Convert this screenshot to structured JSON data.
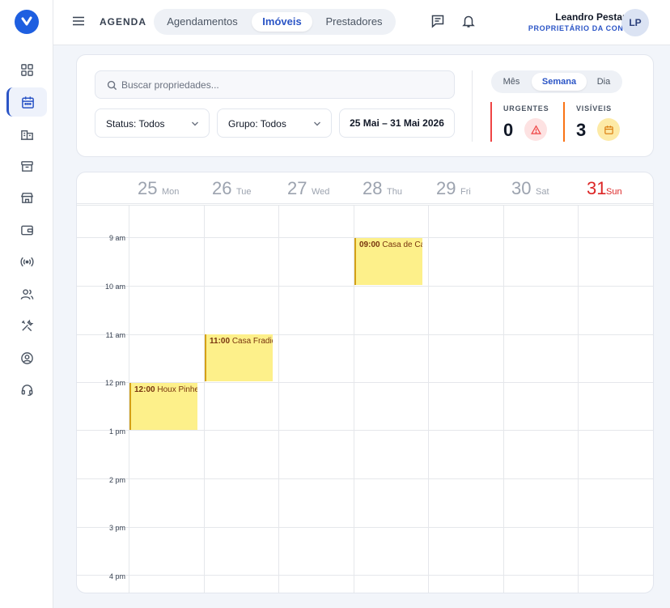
{
  "header": {
    "title": "AGENDA",
    "tabs": [
      {
        "label": "Agendamentos",
        "active": false
      },
      {
        "label": "Imóveis",
        "active": true
      },
      {
        "label": "Prestadores",
        "active": false
      }
    ],
    "user": {
      "name": "Leandro Pestana",
      "role": "PROPRIETÁRIO DA CONTA",
      "initials": "LP"
    }
  },
  "sidebar": {
    "items": [
      {
        "icon": "grid-icon",
        "active": false
      },
      {
        "icon": "calendar-icon",
        "active": true
      },
      {
        "icon": "buildings-icon",
        "active": false
      },
      {
        "icon": "archive-icon",
        "active": false
      },
      {
        "icon": "store-icon",
        "active": false
      },
      {
        "icon": "wallet-icon",
        "active": false
      },
      {
        "icon": "broadcast-icon",
        "active": false
      },
      {
        "icon": "users-icon",
        "active": false
      },
      {
        "icon": "tools-icon",
        "active": false
      },
      {
        "icon": "user-circle-icon",
        "active": false
      },
      {
        "icon": "headset-icon",
        "active": false
      }
    ]
  },
  "filters": {
    "search_placeholder": "Buscar propriedades...",
    "status": "Status: Todos",
    "group": "Grupo: Todos",
    "date_range": "25 Mai – 31 Mai 2026",
    "views": [
      {
        "label": "Mês",
        "active": false
      },
      {
        "label": "Semana",
        "active": true
      },
      {
        "label": "Dia",
        "active": false
      }
    ],
    "stats": [
      {
        "label": "URGENTES",
        "value": "0",
        "color": "#ef4444",
        "icon": "warning-icon"
      },
      {
        "label": "VISÍVEIS",
        "value": "3",
        "color": "#f97316",
        "icon": "calendar-icon"
      }
    ]
  },
  "calendar": {
    "days": [
      {
        "num": "25",
        "name": "Mon"
      },
      {
        "num": "26",
        "name": "Tue"
      },
      {
        "num": "27",
        "name": "Wed"
      },
      {
        "num": "28",
        "name": "Thu"
      },
      {
        "num": "29",
        "name": "Fri"
      },
      {
        "num": "30",
        "name": "Sat"
      },
      {
        "num": "31",
        "name": "Sun"
      }
    ],
    "times": [
      "9 am",
      "10 am",
      "11 am",
      "12 pm",
      "1 pm",
      "2 pm",
      "3 pm",
      "4 pm"
    ],
    "events": [
      {
        "time": "09:00",
        "title": "Casa de Campo",
        "day": "28"
      },
      {
        "time": "11:00",
        "title": "Casa Fradique",
        "day": "26"
      },
      {
        "time": "12:00",
        "title": "Houx Pinheiro",
        "day": "25"
      }
    ]
  },
  "colors": {
    "accent": "#2b55c6",
    "brand": "#1e5fe0",
    "event_bg": "#fdf08a",
    "sunday": "#dc2626"
  }
}
